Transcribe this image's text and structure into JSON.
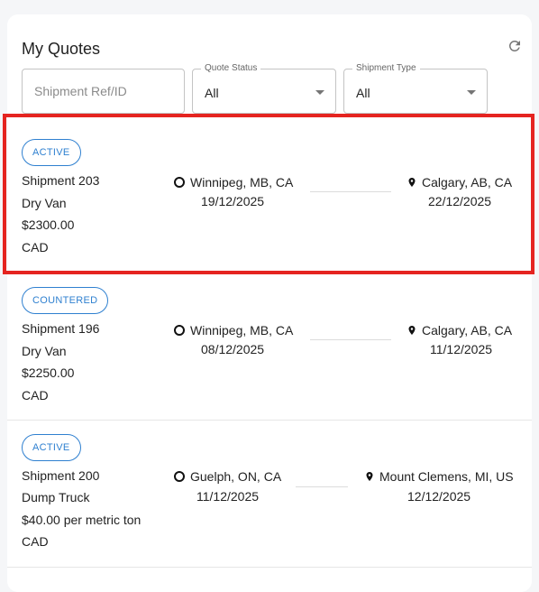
{
  "header": {
    "title": "My Quotes"
  },
  "filters": {
    "search_placeholder": "Shipment Ref/ID",
    "quote_status_label": "Quote Status",
    "quote_status_value": "All",
    "shipment_type_label": "Shipment Type",
    "shipment_type_value": "All"
  },
  "quotes": [
    {
      "status": "ACTIVE",
      "shipment": "Shipment 203",
      "equipment": "Dry Van",
      "price": "$2300.00",
      "currency": "CAD",
      "origin": "Winnipeg, MB, CA",
      "origin_date": "19/12/2025",
      "destination": "Calgary, AB, CA",
      "destination_date": "22/12/2025"
    },
    {
      "status": "COUNTERED",
      "shipment": "Shipment 196",
      "equipment": "Dry Van",
      "price": "$2250.00",
      "currency": "CAD",
      "origin": "Winnipeg, MB, CA",
      "origin_date": "08/12/2025",
      "destination": "Calgary, AB, CA",
      "destination_date": "11/12/2025"
    },
    {
      "status": "ACTIVE",
      "shipment": "Shipment 200",
      "equipment": "Dump Truck",
      "price": "$40.00 per metric ton",
      "currency": "CAD",
      "origin": "Guelph, ON, CA",
      "origin_date": "11/12/2025",
      "destination": "Mount Clemens, MI, US",
      "destination_date": "12/12/2025"
    }
  ],
  "colors": {
    "accent": "#2f80d0",
    "highlight": "#e52420"
  }
}
